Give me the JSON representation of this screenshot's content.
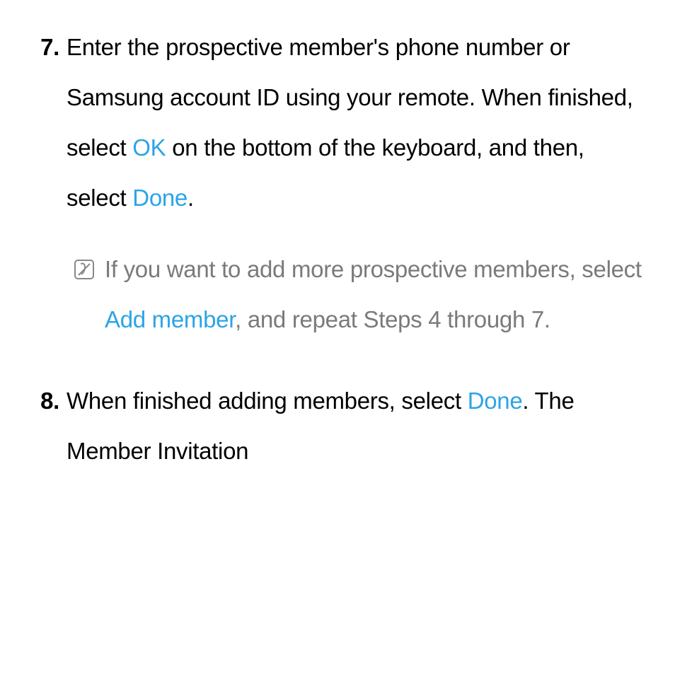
{
  "steps": {
    "step7": {
      "number": "7.",
      "text_part1": "Enter the prospective member's phone number or Samsung account ID using your remote. When finished, select ",
      "ok_label": "OK",
      "text_part2": " on the bottom of the keyboard, and then, select ",
      "done_label": "Done",
      "text_part3": "."
    },
    "note": {
      "text_part1": "If you want to add more prospective members, select ",
      "add_member_label": "Add member",
      "text_part2": ", and repeat Steps 4 through 7."
    },
    "step8": {
      "number": "8.",
      "text_part1": "When finished adding members, select ",
      "done_label": "Done",
      "text_part2": ". The Member Invitation"
    }
  }
}
